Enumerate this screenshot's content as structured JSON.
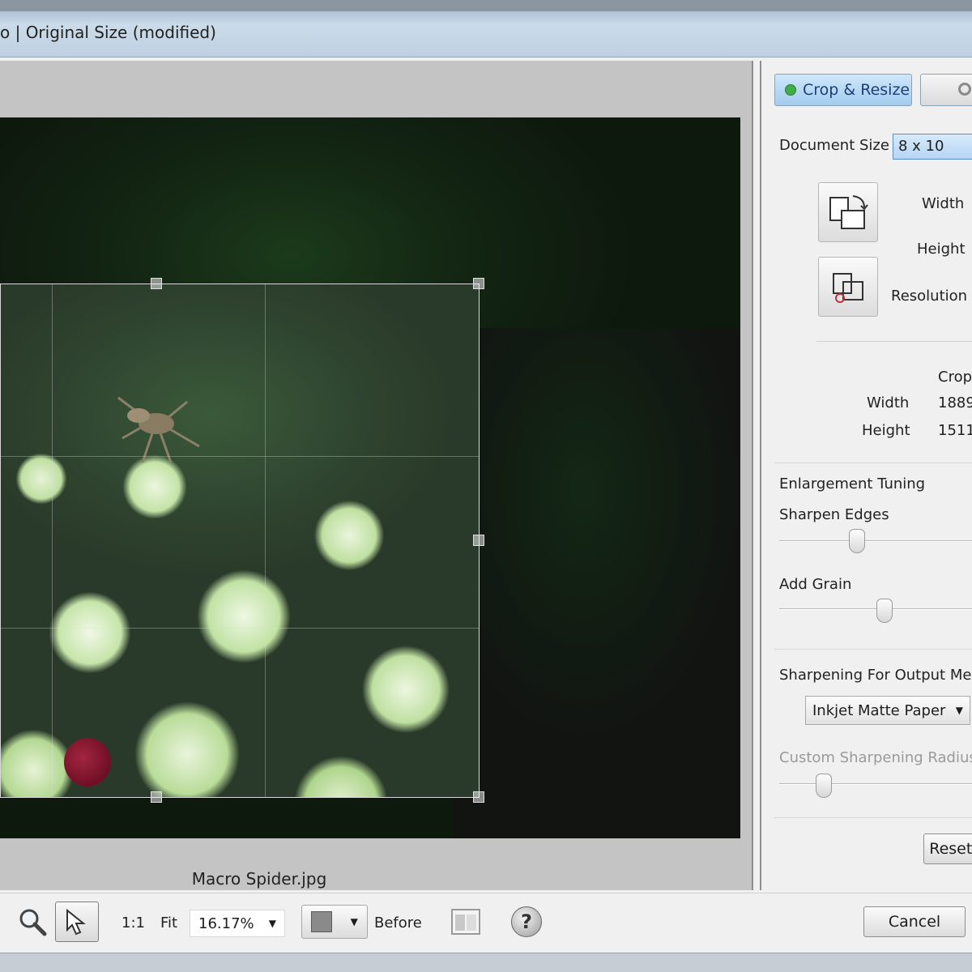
{
  "window": {
    "title": "o | Original Size (modified)"
  },
  "preview": {
    "filename": "Macro Spider.jpg"
  },
  "panel": {
    "tabs": [
      {
        "label": "Crop & Resize",
        "active": true,
        "icon": "green-dot-icon"
      },
      {
        "label": "",
        "active": false,
        "icon": "settings-icon"
      }
    ],
    "document_size": {
      "label": "Document Size",
      "value": "8 x 10"
    },
    "dimension_labels": {
      "width": "Width",
      "height": "Height",
      "resolution": "Resolution"
    },
    "crop": {
      "header": "Crop",
      "width_label": "Width",
      "width_value": "1889",
      "height_label": "Height",
      "height_value": "1511"
    },
    "enlargement": {
      "title": "Enlargement Tuning",
      "sharpen_label": "Sharpen Edges",
      "sharpen_level": 0.38,
      "grain_label": "Add Grain",
      "grain_level": 0.53
    },
    "output": {
      "title": "Sharpening For Output Medi",
      "media_value": "Inkjet Matte Paper",
      "radius_label": "Custom Sharpening Radius",
      "radius_level": 0.2
    },
    "reset_label": "Reset /"
  },
  "toolbar": {
    "zoom_one_label": "1:1",
    "fit_label": "Fit",
    "zoom_value": "16.17%",
    "before_label": "Before",
    "help_glyph": "?",
    "cancel_label": "Cancel"
  },
  "colors": {
    "accent_blue": "#a3cbee",
    "active_dot": "#3fae47"
  }
}
